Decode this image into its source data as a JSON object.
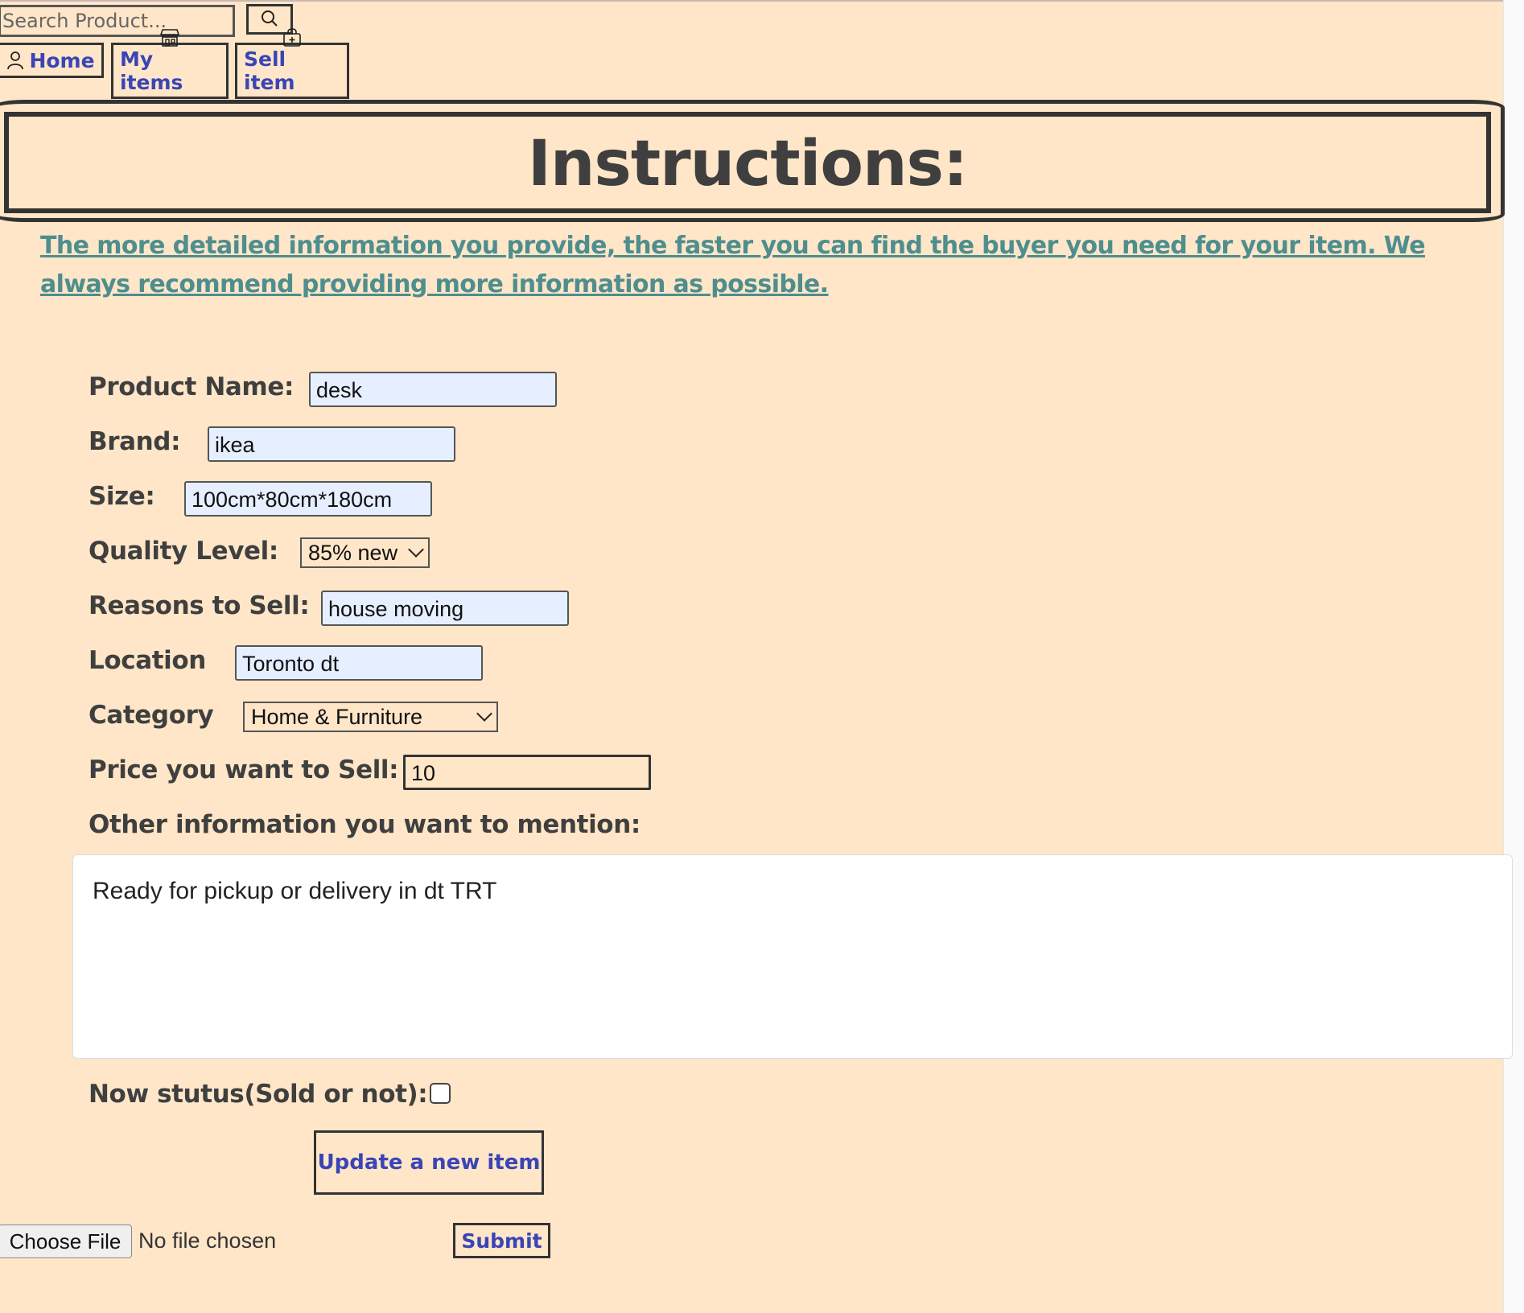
{
  "search": {
    "placeholder": "Search Product..."
  },
  "nav": {
    "home": "Home",
    "my_items": "My items",
    "sell_item": "Sell item"
  },
  "instructions": {
    "title": "Instructions:",
    "text": "The more detailed information you provide, the faster you can find the buyer you need for your item. We always recommend providing more information as possible."
  },
  "form": {
    "product_name": {
      "label": "Product Name:",
      "value": "desk"
    },
    "brand": {
      "label": "Brand:",
      "value": "ikea"
    },
    "size": {
      "label": "Size:",
      "value": "100cm*80cm*180cm"
    },
    "quality": {
      "label": "Quality Level:",
      "value": "85% new"
    },
    "reasons": {
      "label": "Reasons to Sell:",
      "value": "house moving"
    },
    "location": {
      "label": "Location",
      "value": "Toronto dt"
    },
    "category": {
      "label": "Category",
      "value": "Home & Furniture"
    },
    "price": {
      "label": "Price you want to Sell:",
      "value": "10"
    },
    "other": {
      "label": "Other information you want to mention:",
      "value": "Ready for pickup or delivery in dt TRT"
    },
    "status": {
      "label": "Now stutus(Sold or not):",
      "checked": false
    },
    "update_button": "Update a new item"
  },
  "upload": {
    "choose_file": "Choose File",
    "status": "No file chosen",
    "submit": "Submit"
  },
  "colors": {
    "background": "#ffe6c8",
    "link_blue": "#3a45b5",
    "instruction_teal": "#4e8e8e",
    "input_fill": "#e6efff"
  }
}
